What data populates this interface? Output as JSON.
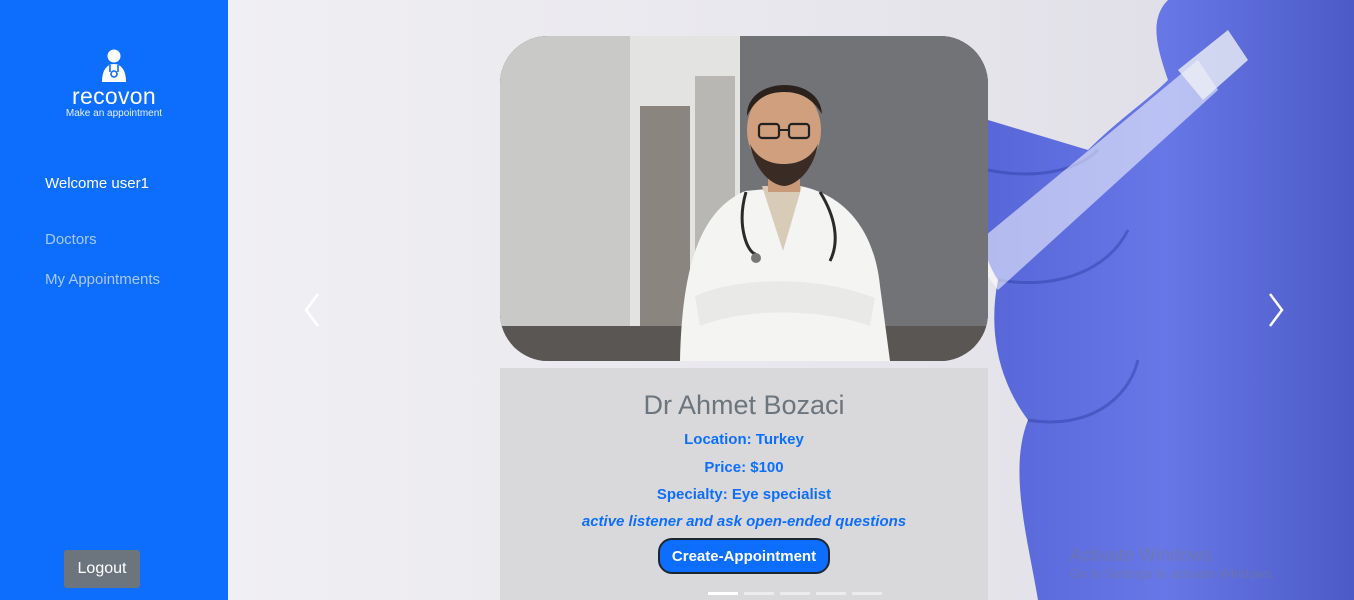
{
  "brand": {
    "name": "recovon",
    "tagline": "Make an appointment"
  },
  "sidebar": {
    "welcome": "Welcome user1",
    "items": [
      {
        "label": "Doctors"
      },
      {
        "label": "My Appointments"
      }
    ],
    "logout_label": "Logout"
  },
  "doctor": {
    "name": "Dr Ahmet Bozaci",
    "location": "Location: Turkey",
    "price": "Price: $100",
    "specialty": "Specialty: Eye specialist",
    "description": "active listener and ask open-ended questions",
    "button_label": "Create-Appointment"
  },
  "carousel": {
    "slide_count": 5,
    "active_index": 0
  },
  "watermark": {
    "title": "Activate Windows",
    "subtitle": "Go to Settings to activate Windows."
  },
  "colors": {
    "sidebar": "#0d6efd",
    "accent": "#0d6efd",
    "logout": "#6c757d"
  }
}
